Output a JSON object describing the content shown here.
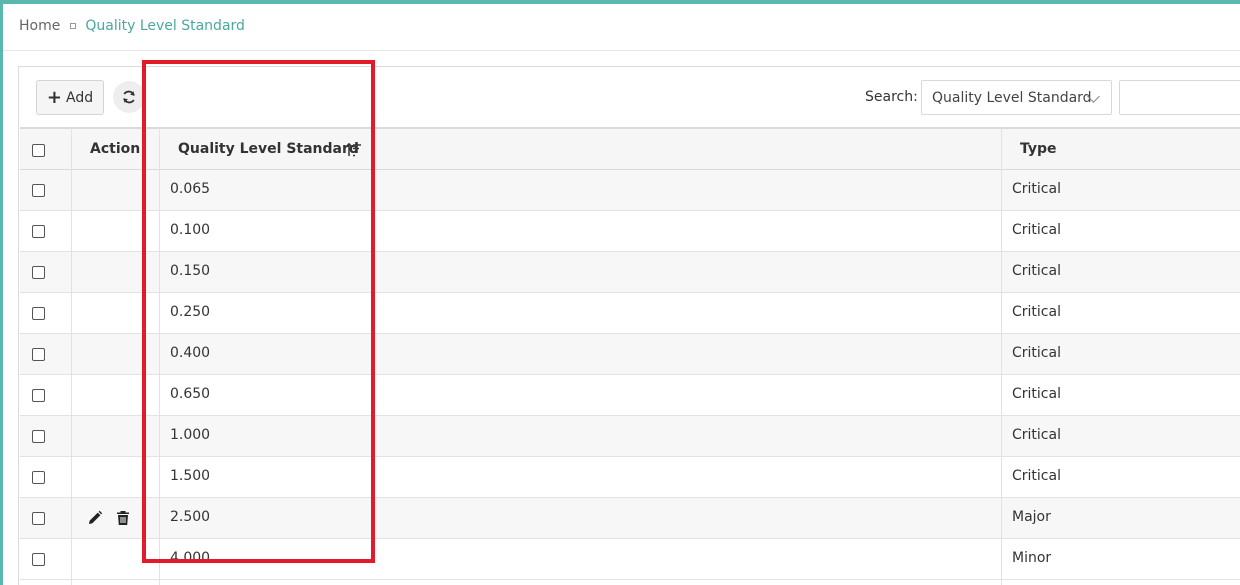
{
  "breadcrumb": {
    "home": "Home",
    "current": "Quality Level Standard"
  },
  "toolbar": {
    "add_label": "Add"
  },
  "search": {
    "label": "Search:",
    "selected_field": "Quality Level Standard",
    "query": ""
  },
  "table": {
    "columns": {
      "action": "Action",
      "quality": "Quality Level Standard",
      "type": "Type"
    },
    "rows": [
      {
        "quality": "0.065",
        "type": "Critical"
      },
      {
        "quality": "0.100",
        "type": "Critical"
      },
      {
        "quality": "0.150",
        "type": "Critical"
      },
      {
        "quality": "0.250",
        "type": "Critical"
      },
      {
        "quality": "0.400",
        "type": "Critical"
      },
      {
        "quality": "0.650",
        "type": "Critical"
      },
      {
        "quality": "1.000",
        "type": "Critical"
      },
      {
        "quality": "1.500",
        "type": "Critical"
      },
      {
        "quality": "2.500",
        "type": "Major"
      },
      {
        "quality": "4.000",
        "type": "Minor"
      }
    ]
  },
  "colors": {
    "accent": "#4aa89e",
    "highlight": "#e21b2a"
  },
  "icons": {
    "refresh": "refresh-icon",
    "sort": "sort-icon",
    "edit": "pencil-icon",
    "delete": "trash-icon",
    "separator": "square-icon"
  }
}
